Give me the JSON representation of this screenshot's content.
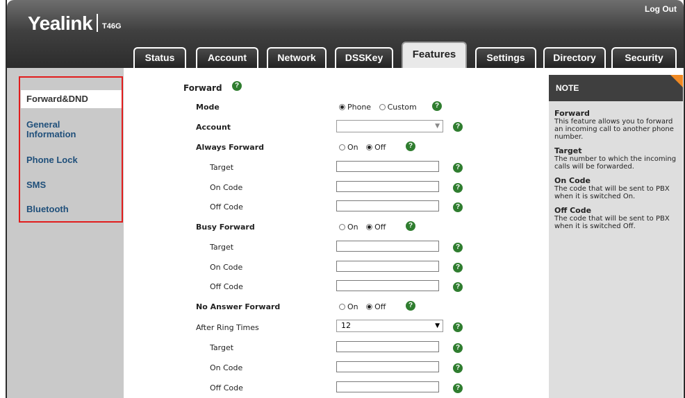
{
  "header": {
    "logo": "Yealink",
    "model": "T46G",
    "logout": "Log Out"
  },
  "tabs": [
    {
      "label": "Status"
    },
    {
      "label": "Account"
    },
    {
      "label": "Network"
    },
    {
      "label": "DSSKey"
    },
    {
      "label": "Features"
    },
    {
      "label": "Settings"
    },
    {
      "label": "Directory"
    },
    {
      "label": "Security"
    }
  ],
  "active_tab": "Features",
  "sidebar": {
    "items": [
      {
        "label": "Forward&DND"
      },
      {
        "label": "General Information"
      },
      {
        "label": "Phone Lock"
      },
      {
        "label": "SMS"
      },
      {
        "label": "Bluetooth"
      }
    ],
    "active": "Forward&DND"
  },
  "form": {
    "section_title": "Forward",
    "mode_label": "Mode",
    "mode_options": [
      "Phone",
      "Custom"
    ],
    "mode_selected": "Phone",
    "account_label": "Account",
    "account_value": "",
    "always_forward": {
      "label": "Always Forward",
      "options": [
        "On",
        "Off"
      ],
      "selected": "Off",
      "target_label": "Target",
      "on_code_label": "On Code",
      "off_code_label": "Off Code"
    },
    "busy_forward": {
      "label": "Busy Forward",
      "options": [
        "On",
        "Off"
      ],
      "selected": "Off",
      "target_label": "Target",
      "on_code_label": "On Code",
      "off_code_label": "Off Code"
    },
    "no_answer_forward": {
      "label": "No Answer Forward",
      "options": [
        "On",
        "Off"
      ],
      "selected": "Off",
      "ring_times_label": "After Ring Times",
      "ring_times_value": "12",
      "target_label": "Target",
      "on_code_label": "On Code",
      "off_code_label": "Off Code"
    }
  },
  "note": {
    "title": "NOTE",
    "entries": [
      {
        "term": "Forward",
        "text": "This feature allows you to forward an incoming call to another phone number."
      },
      {
        "term": "Target",
        "text": "The number to which the incoming calls will be forwarded."
      },
      {
        "term": "On Code",
        "text": "The code that will be sent to PBX when it is switched On."
      },
      {
        "term": "Off Code",
        "text": "The code that will be sent to PBX when it is switched Off."
      }
    ]
  },
  "colors": {
    "header_dark": "#2c2c2c",
    "sidebar_bg": "#c9c9c9",
    "nav_link": "#1f4f7a",
    "highlight_border": "#e11c1c",
    "help_icon": "#2f7d2f",
    "note_accent": "#f08a24"
  }
}
